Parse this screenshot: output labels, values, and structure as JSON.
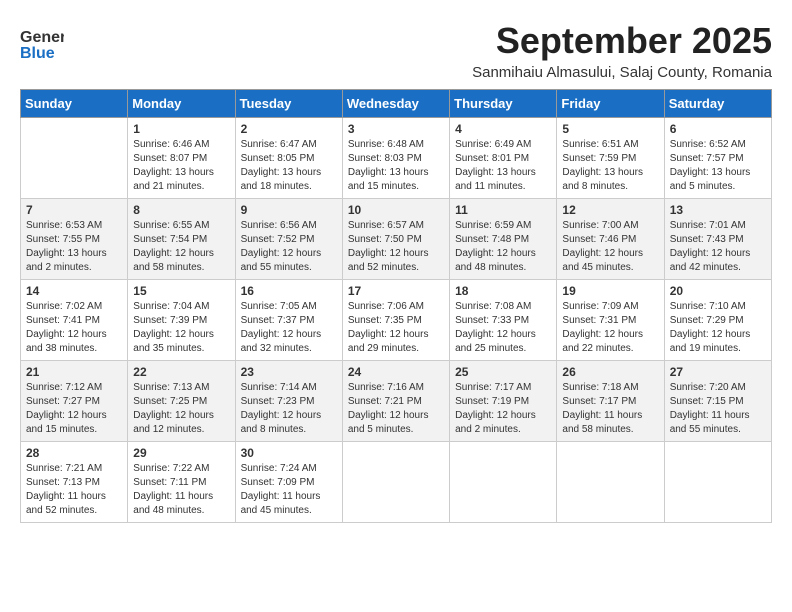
{
  "logo": {
    "general": "General",
    "blue": "Blue",
    "tagline": ""
  },
  "title": "September 2025",
  "subtitle": "Sanmihaiu Almasului, Salaj County, Romania",
  "headers": [
    "Sunday",
    "Monday",
    "Tuesday",
    "Wednesday",
    "Thursday",
    "Friday",
    "Saturday"
  ],
  "weeks": [
    {
      "shaded": false,
      "days": [
        {
          "num": "",
          "info": ""
        },
        {
          "num": "1",
          "info": "Sunrise: 6:46 AM\nSunset: 8:07 PM\nDaylight: 13 hours\nand 21 minutes."
        },
        {
          "num": "2",
          "info": "Sunrise: 6:47 AM\nSunset: 8:05 PM\nDaylight: 13 hours\nand 18 minutes."
        },
        {
          "num": "3",
          "info": "Sunrise: 6:48 AM\nSunset: 8:03 PM\nDaylight: 13 hours\nand 15 minutes."
        },
        {
          "num": "4",
          "info": "Sunrise: 6:49 AM\nSunset: 8:01 PM\nDaylight: 13 hours\nand 11 minutes."
        },
        {
          "num": "5",
          "info": "Sunrise: 6:51 AM\nSunset: 7:59 PM\nDaylight: 13 hours\nand 8 minutes."
        },
        {
          "num": "6",
          "info": "Sunrise: 6:52 AM\nSunset: 7:57 PM\nDaylight: 13 hours\nand 5 minutes."
        }
      ]
    },
    {
      "shaded": true,
      "days": [
        {
          "num": "7",
          "info": "Sunrise: 6:53 AM\nSunset: 7:55 PM\nDaylight: 13 hours\nand 2 minutes."
        },
        {
          "num": "8",
          "info": "Sunrise: 6:55 AM\nSunset: 7:54 PM\nDaylight: 12 hours\nand 58 minutes."
        },
        {
          "num": "9",
          "info": "Sunrise: 6:56 AM\nSunset: 7:52 PM\nDaylight: 12 hours\nand 55 minutes."
        },
        {
          "num": "10",
          "info": "Sunrise: 6:57 AM\nSunset: 7:50 PM\nDaylight: 12 hours\nand 52 minutes."
        },
        {
          "num": "11",
          "info": "Sunrise: 6:59 AM\nSunset: 7:48 PM\nDaylight: 12 hours\nand 48 minutes."
        },
        {
          "num": "12",
          "info": "Sunrise: 7:00 AM\nSunset: 7:46 PM\nDaylight: 12 hours\nand 45 minutes."
        },
        {
          "num": "13",
          "info": "Sunrise: 7:01 AM\nSunset: 7:43 PM\nDaylight: 12 hours\nand 42 minutes."
        }
      ]
    },
    {
      "shaded": false,
      "days": [
        {
          "num": "14",
          "info": "Sunrise: 7:02 AM\nSunset: 7:41 PM\nDaylight: 12 hours\nand 38 minutes."
        },
        {
          "num": "15",
          "info": "Sunrise: 7:04 AM\nSunset: 7:39 PM\nDaylight: 12 hours\nand 35 minutes."
        },
        {
          "num": "16",
          "info": "Sunrise: 7:05 AM\nSunset: 7:37 PM\nDaylight: 12 hours\nand 32 minutes."
        },
        {
          "num": "17",
          "info": "Sunrise: 7:06 AM\nSunset: 7:35 PM\nDaylight: 12 hours\nand 29 minutes."
        },
        {
          "num": "18",
          "info": "Sunrise: 7:08 AM\nSunset: 7:33 PM\nDaylight: 12 hours\nand 25 minutes."
        },
        {
          "num": "19",
          "info": "Sunrise: 7:09 AM\nSunset: 7:31 PM\nDaylight: 12 hours\nand 22 minutes."
        },
        {
          "num": "20",
          "info": "Sunrise: 7:10 AM\nSunset: 7:29 PM\nDaylight: 12 hours\nand 19 minutes."
        }
      ]
    },
    {
      "shaded": true,
      "days": [
        {
          "num": "21",
          "info": "Sunrise: 7:12 AM\nSunset: 7:27 PM\nDaylight: 12 hours\nand 15 minutes."
        },
        {
          "num": "22",
          "info": "Sunrise: 7:13 AM\nSunset: 7:25 PM\nDaylight: 12 hours\nand 12 minutes."
        },
        {
          "num": "23",
          "info": "Sunrise: 7:14 AM\nSunset: 7:23 PM\nDaylight: 12 hours\nand 8 minutes."
        },
        {
          "num": "24",
          "info": "Sunrise: 7:16 AM\nSunset: 7:21 PM\nDaylight: 12 hours\nand 5 minutes."
        },
        {
          "num": "25",
          "info": "Sunrise: 7:17 AM\nSunset: 7:19 PM\nDaylight: 12 hours\nand 2 minutes."
        },
        {
          "num": "26",
          "info": "Sunrise: 7:18 AM\nSunset: 7:17 PM\nDaylight: 11 hours\nand 58 minutes."
        },
        {
          "num": "27",
          "info": "Sunrise: 7:20 AM\nSunset: 7:15 PM\nDaylight: 11 hours\nand 55 minutes."
        }
      ]
    },
    {
      "shaded": false,
      "days": [
        {
          "num": "28",
          "info": "Sunrise: 7:21 AM\nSunset: 7:13 PM\nDaylight: 11 hours\nand 52 minutes."
        },
        {
          "num": "29",
          "info": "Sunrise: 7:22 AM\nSunset: 7:11 PM\nDaylight: 11 hours\nand 48 minutes."
        },
        {
          "num": "30",
          "info": "Sunrise: 7:24 AM\nSunset: 7:09 PM\nDaylight: 11 hours\nand 45 minutes."
        },
        {
          "num": "",
          "info": ""
        },
        {
          "num": "",
          "info": ""
        },
        {
          "num": "",
          "info": ""
        },
        {
          "num": "",
          "info": ""
        }
      ]
    }
  ]
}
